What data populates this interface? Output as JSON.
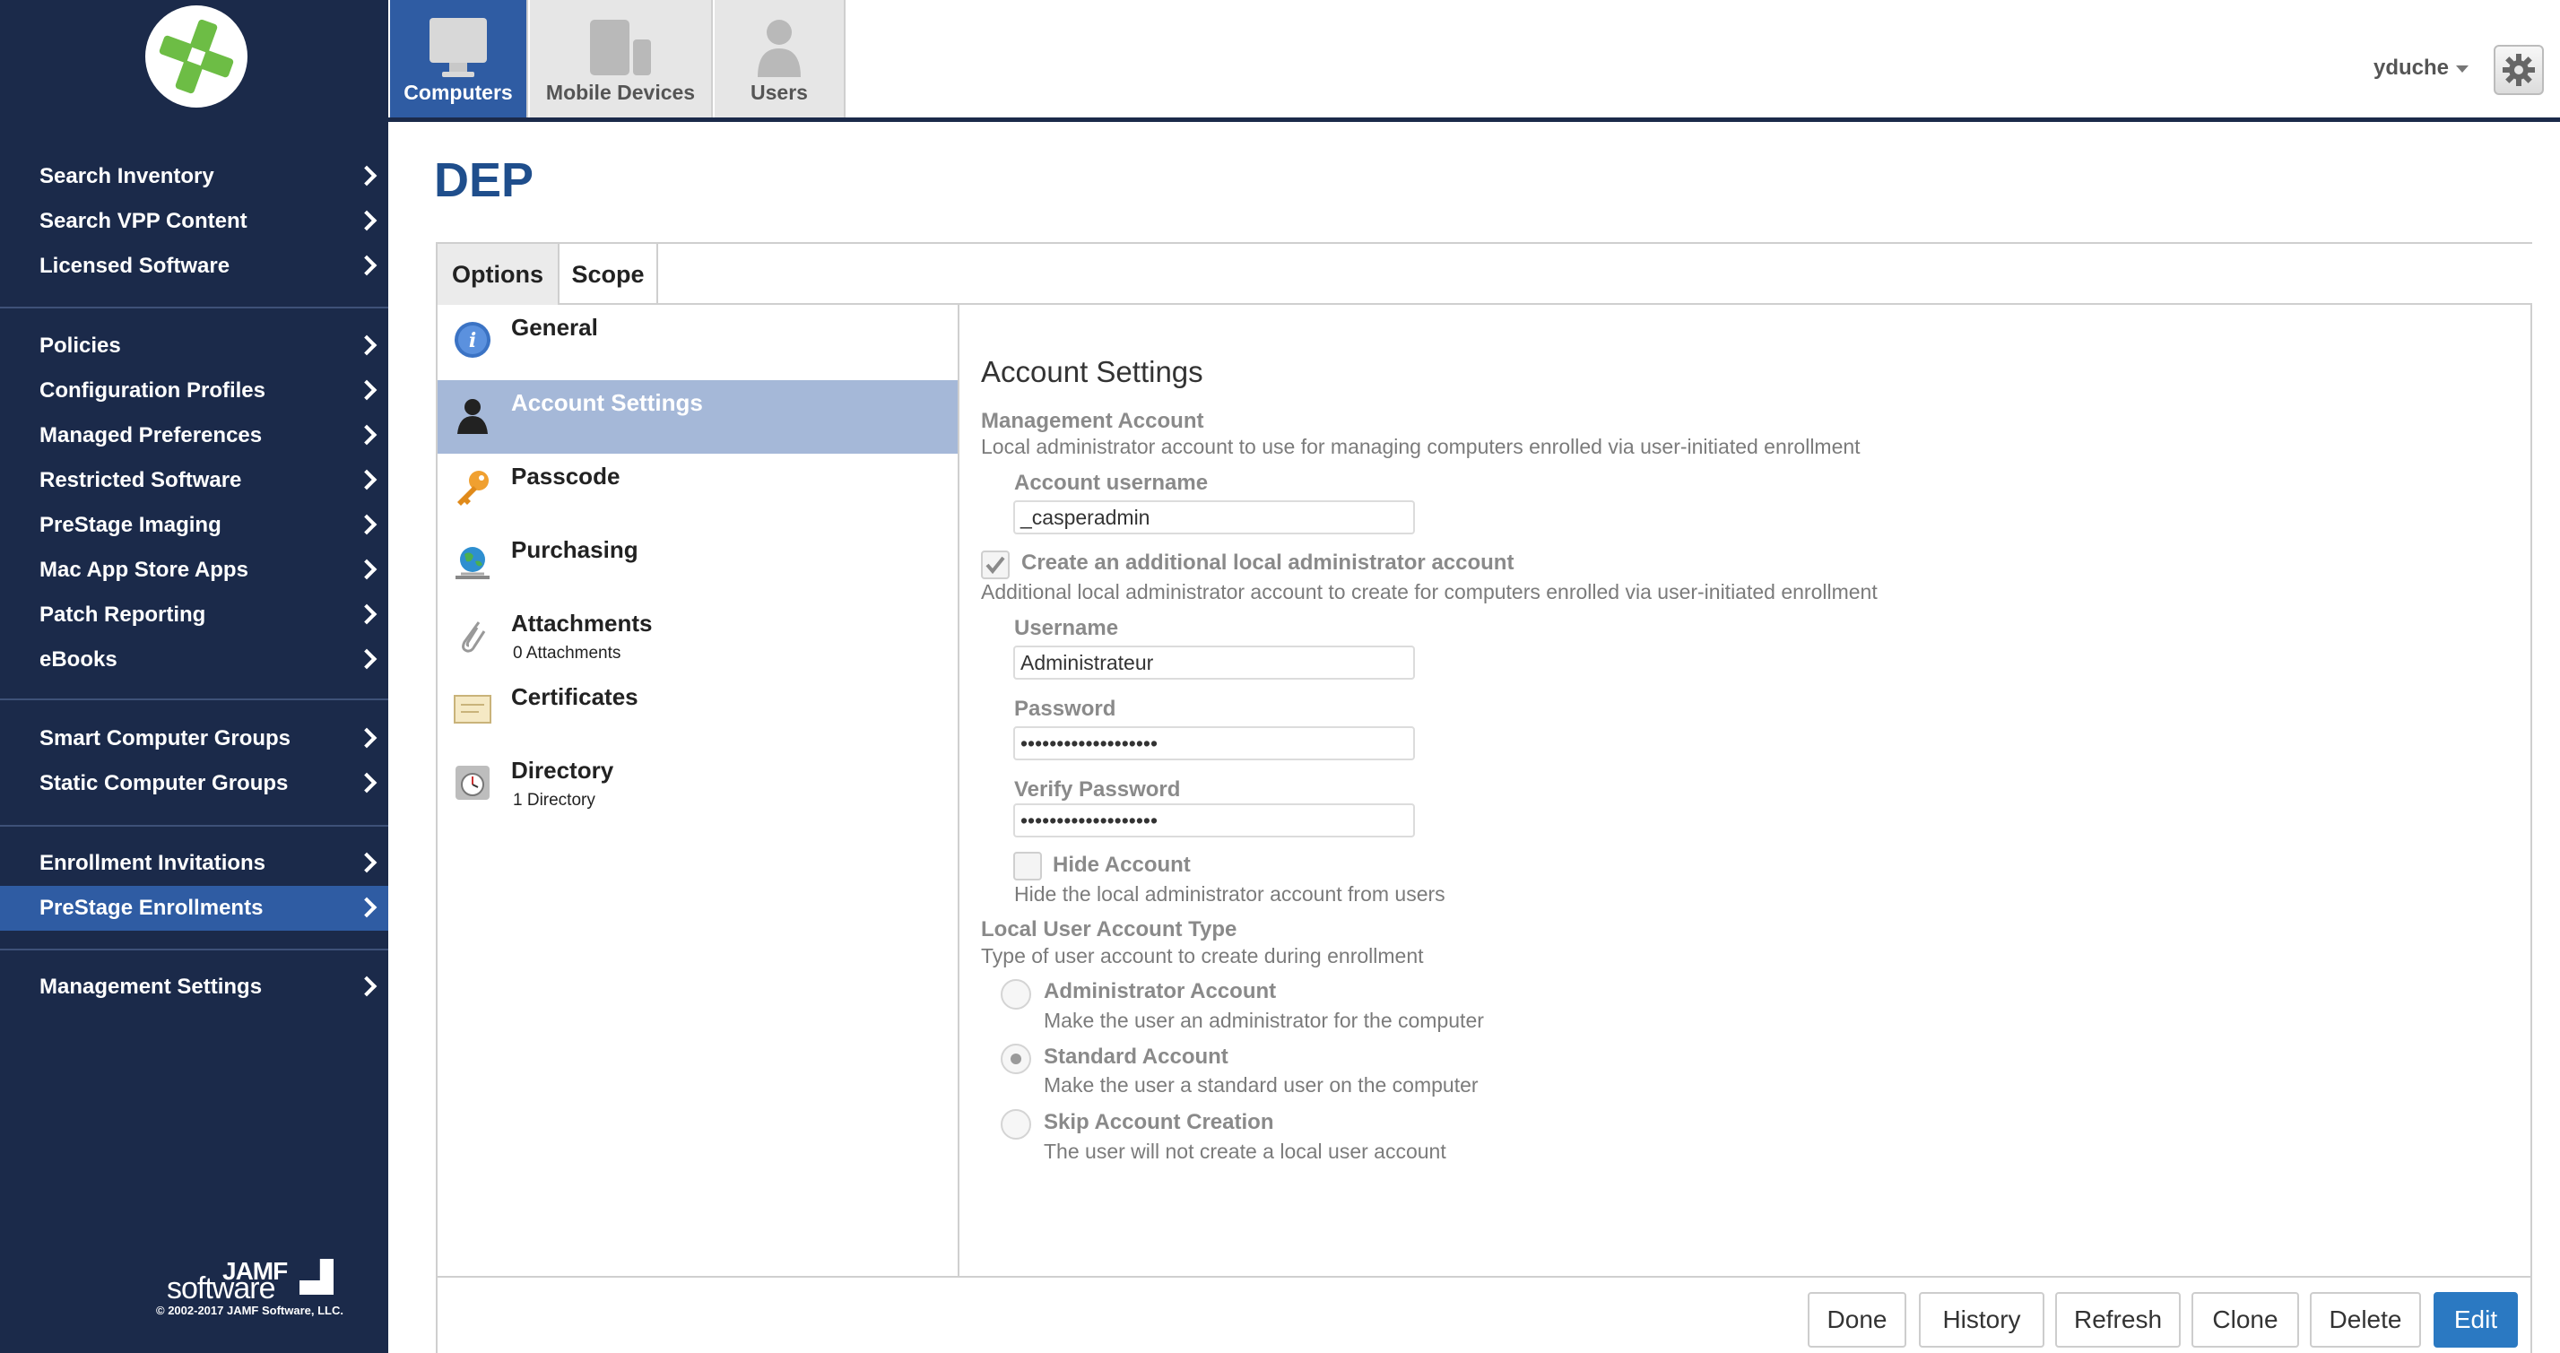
{
  "brand": {
    "accent": "#2f5ca3",
    "sidebar_bg": "#1b2a4a",
    "logo_green": "#6dbd45"
  },
  "sidebar": {
    "groups": [
      {
        "items": [
          {
            "label": "Search Inventory"
          },
          {
            "label": "Search VPP Content"
          },
          {
            "label": "Licensed Software"
          }
        ]
      },
      {
        "items": [
          {
            "label": "Policies"
          },
          {
            "label": "Configuration Profiles"
          },
          {
            "label": "Managed Preferences"
          },
          {
            "label": "Restricted Software"
          },
          {
            "label": "PreStage Imaging"
          },
          {
            "label": "Mac App Store Apps"
          },
          {
            "label": "Patch Reporting"
          },
          {
            "label": "eBooks"
          }
        ]
      },
      {
        "items": [
          {
            "label": "Smart Computer Groups"
          },
          {
            "label": "Static Computer Groups"
          }
        ]
      },
      {
        "items": [
          {
            "label": "Enrollment Invitations"
          },
          {
            "label": "PreStage Enrollments",
            "active": true
          }
        ]
      },
      {
        "items": [
          {
            "label": "Management Settings"
          }
        ]
      }
    ],
    "footer_logo_top": "JAMF",
    "footer_logo_bottom": "software",
    "copyright": "© 2002-2017 JAMF Software, LLC."
  },
  "topnav": {
    "tabs": [
      {
        "label": "Computers",
        "icon": "computer-icon",
        "active": true
      },
      {
        "label": "Mobile Devices",
        "icon": "mobile-devices-icon"
      },
      {
        "label": "Users",
        "icon": "user-icon"
      }
    ],
    "username": "yduche"
  },
  "page": {
    "title": "DEP"
  },
  "panel": {
    "tabs": [
      {
        "label": "Options"
      },
      {
        "label": "Scope"
      }
    ],
    "left_items": [
      {
        "label": "General",
        "icon": "info-icon"
      },
      {
        "label": "Account Settings",
        "icon": "person-icon",
        "active": true
      },
      {
        "label": "Passcode",
        "icon": "key-icon"
      },
      {
        "label": "Purchasing",
        "icon": "globe-icon"
      },
      {
        "label": "Attachments",
        "sub": "0 Attachments",
        "icon": "paperclip-icon"
      },
      {
        "label": "Certificates",
        "icon": "certificate-icon"
      },
      {
        "label": "Directory",
        "sub": "1 Directory",
        "icon": "directory-icon"
      }
    ]
  },
  "account_settings": {
    "heading": "Account Settings",
    "mgmt_title": "Management Account",
    "mgmt_desc": "Local administrator account to use for managing computers enrolled via user-initiated enrollment",
    "account_username_label": "Account username",
    "account_username_value": "_casperadmin",
    "create_additional_label": "Create an additional local administrator account",
    "create_additional_checked": true,
    "create_additional_desc": "Additional local administrator account to create for computers enrolled via user-initiated enrollment",
    "username_label": "Username",
    "username_value": "Administrateur",
    "password_label": "Password",
    "password_value": "•••••••••••••••••••",
    "verify_label": "Verify Password",
    "verify_value": "•••••••••••••••••••",
    "hide_account_label": "Hide Account",
    "hide_account_desc": "Hide the local administrator account from users",
    "hide_account_checked": false,
    "account_type_title": "Local User Account Type",
    "account_type_desc": "Type of user account to create during enrollment",
    "options": [
      {
        "label": "Administrator Account",
        "desc": "Make the user an administrator for the computer",
        "selected": false
      },
      {
        "label": "Standard Account",
        "desc": "Make the user a standard user on the computer",
        "selected": true
      },
      {
        "label": "Skip Account Creation",
        "desc": "The user will not create a local user account",
        "selected": false
      }
    ]
  },
  "footer": {
    "buttons": [
      {
        "label": "Done"
      },
      {
        "label": "History"
      },
      {
        "label": "Refresh"
      },
      {
        "label": "Clone"
      },
      {
        "label": "Delete"
      },
      {
        "label": "Edit",
        "primary": true
      }
    ]
  }
}
